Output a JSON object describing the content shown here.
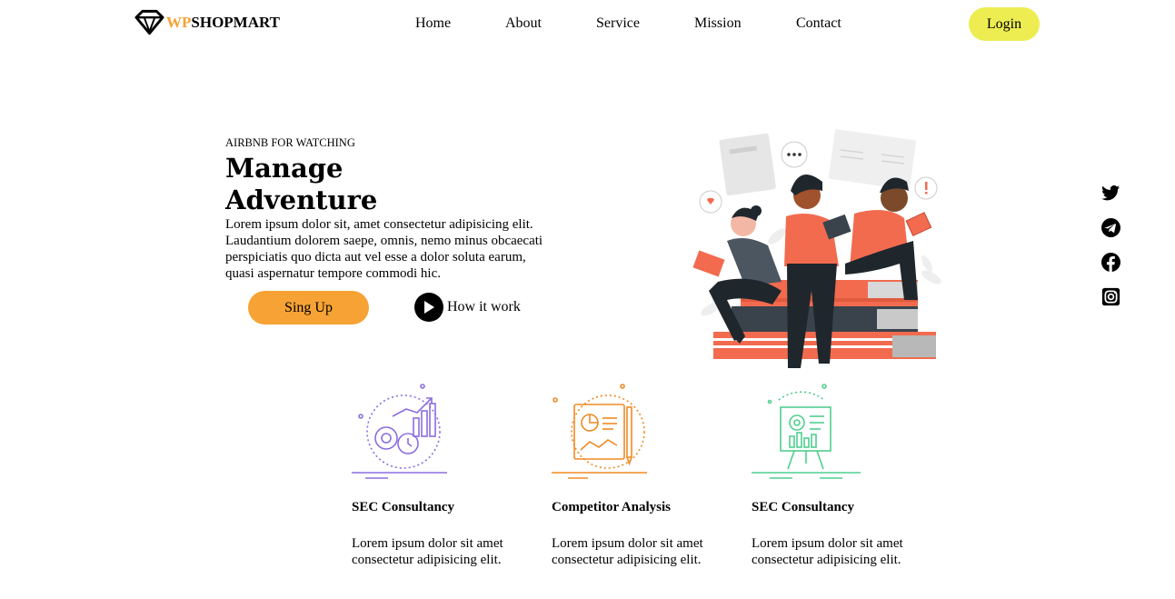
{
  "header": {
    "logo": {
      "prefix": "WP",
      "name": "SHOPMART"
    },
    "nav": [
      "Home",
      "About",
      "Service",
      "Mission",
      "Contact"
    ],
    "login_label": "Login"
  },
  "hero": {
    "eyebrow": "AIRBNB FOR WATCHING",
    "title_line1": "Manage",
    "title_line2": "Adventure",
    "description": "Lorem ipsum dolor sit, amet consectetur adipisicing elit. Laudantium dolorem saepe, omnis, nemo minus obcaecati perspiciatis quo dicta aut vel esse a dolor soluta earum, quasi aspernatur tempore commodi hic.",
    "signup_label": "Sing Up",
    "how_label": "How it work"
  },
  "social": [
    "twitter-icon",
    "telegram-icon",
    "facebook-icon",
    "instagram-icon"
  ],
  "services": [
    {
      "icon": "growth-gears-icon",
      "title": "SEC Consultancy",
      "text": "Lorem ipsum dolor sit amet consectetur adipisicing elit."
    },
    {
      "icon": "report-analysis-icon",
      "title": "Competitor Analysis",
      "text": "Lorem ipsum dolor sit amet consectetur adipisicing elit."
    },
    {
      "icon": "presentation-board-icon",
      "title": "SEC Consultancy",
      "text": "Lorem ipsum dolor sit amet consectetur adipisicing elit."
    }
  ],
  "colors": {
    "accent_orange": "#f7a234",
    "login_yellow": "#eded52",
    "illustration_coral": "#f26b4f"
  }
}
